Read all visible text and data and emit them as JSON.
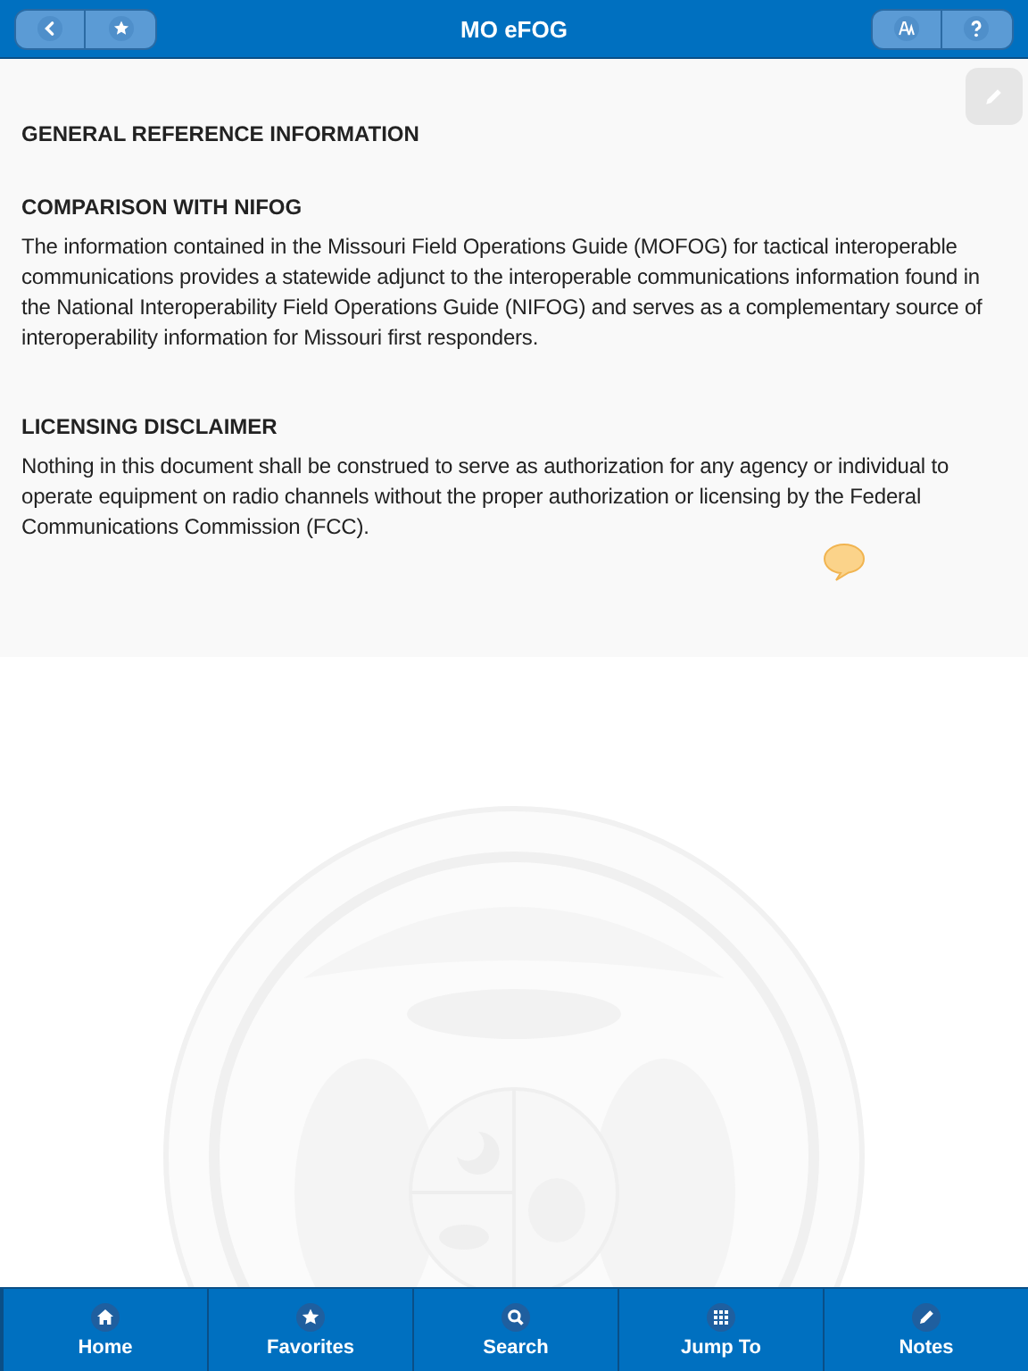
{
  "header": {
    "title": "MO eFOG"
  },
  "content": {
    "title": "GENERAL REFERENCE INFORMATION",
    "sections": [
      {
        "heading": "COMPARISON WITH NIFOG",
        "text": "The information contained in the Missouri Field Operations Guide (MOFOG) for tactical interoperable communications provides a statewide adjunct to the interoperable communications information found in the National Interoperability Field Operations Guide (NIFOG) and serves as a complementary source of interoperability information for Missouri first responders."
      },
      {
        "heading": "LICENSING DISCLAIMER",
        "text": "Nothing in this document shall be construed to serve as authorization for any agency or individual to operate equipment on radio channels without the proper authorization or licensing by the Federal Communications Commission (FCC)."
      }
    ]
  },
  "tab_bar": [
    {
      "kind": "home",
      "label": "Home"
    },
    {
      "kind": "favorites",
      "label": "Favorites"
    },
    {
      "kind": "search",
      "label": "Search"
    },
    {
      "kind": "grid",
      "label": "Jump To"
    },
    {
      "kind": "notes",
      "label": "Notes"
    }
  ]
}
